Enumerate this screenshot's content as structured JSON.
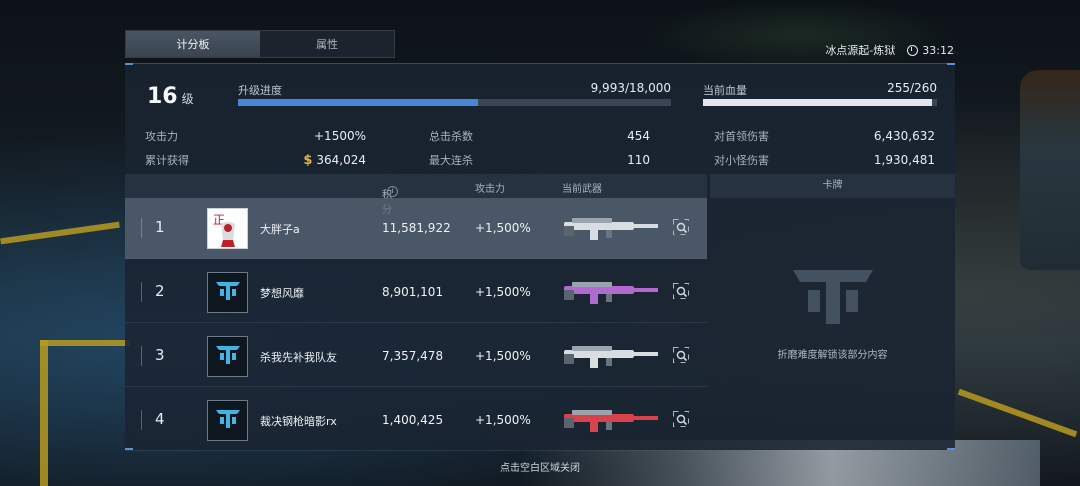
{
  "tabs": [
    {
      "label": "计分板",
      "active": true
    },
    {
      "label": "属性",
      "active": false
    }
  ],
  "header": {
    "map_name": "冰点源起-炼狱",
    "timer": "33:12"
  },
  "player": {
    "level": "16",
    "level_unit": "级",
    "progress_label": "升级进度",
    "progress_value": "9,993/18,000",
    "progress_fraction": 0.555,
    "hp_label": "当前血量",
    "hp_value": "255/260",
    "hp_fraction": 0.98
  },
  "stats": {
    "attack_label": "攻击力",
    "attack_value": "+1500%",
    "earned_label": "累计获得",
    "earned_value": "364,024",
    "kills_label": "总击杀数",
    "kills_value": "454",
    "combo_label": "最大连杀",
    "combo_value": "110",
    "boss_damage_label": "对首领伤害",
    "boss_damage_value": "6,430,632",
    "minion_damage_label": "对小怪伤害",
    "minion_damage_value": "1,930,481"
  },
  "table": {
    "col_score": "积分",
    "col_attack": "攻击力",
    "col_weapon": "当前武器",
    "rows": [
      {
        "rank": "1",
        "name": "大胖子a",
        "score": "11,581,922",
        "attack": "+1,500%",
        "selected": true,
        "avatar": "custom",
        "weapon_color": "#d8dde2"
      },
      {
        "rank": "2",
        "name": "梦想风靡",
        "score": "8,901,101",
        "attack": "+1,500%",
        "selected": false,
        "avatar": "default",
        "weapon_color": "#b06ad0"
      },
      {
        "rank": "3",
        "name": "杀我先补我队友",
        "score": "7,357,478",
        "attack": "+1,500%",
        "selected": false,
        "avatar": "default",
        "weapon_color": "#d8dde2"
      },
      {
        "rank": "4",
        "name": "裁决钢枪暗影rx",
        "score": "1,400,425",
        "attack": "+1,500%",
        "selected": false,
        "avatar": "default",
        "weapon_color": "#d8424a"
      }
    ]
  },
  "cards": {
    "title": "卡牌",
    "locked_message": "折磨难度解锁该部分内容"
  },
  "footer": {
    "close_hint": "点击空白区域关闭"
  },
  "colors": {
    "progress_bar": "#4a86d8",
    "hp_bar": "#e4e7ea",
    "accent": "#5d8fd6",
    "gold": "#e0b64a"
  },
  "icons": {
    "clock": "clock-icon",
    "currency": "dollar-icon",
    "info": "info-icon",
    "inspect": "magnify-icon",
    "avatar_default": "team-logo-icon"
  }
}
